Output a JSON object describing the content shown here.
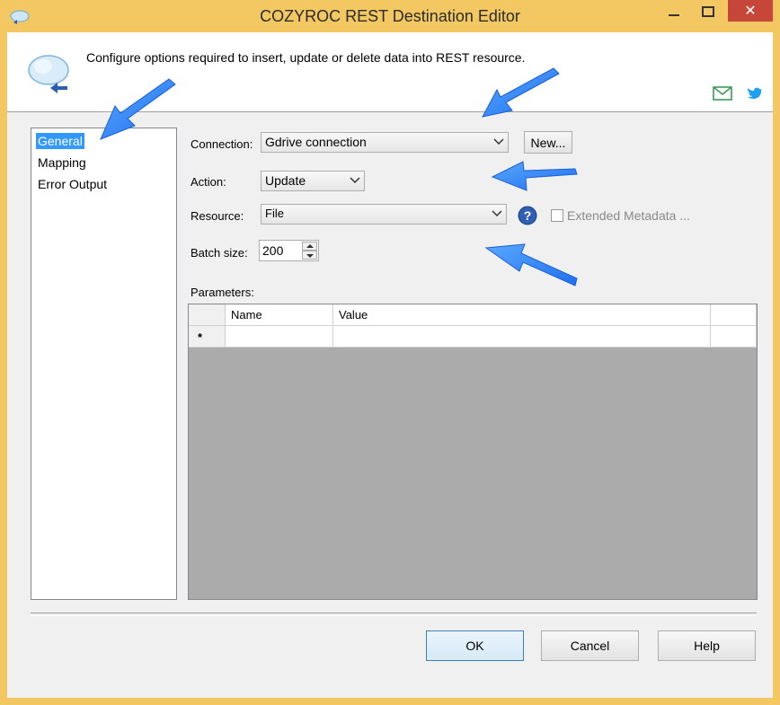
{
  "window": {
    "title": "COZYROC REST Destination Editor",
    "close_glyph": "✕"
  },
  "header": {
    "description": "Configure options required to insert, update or delete data into REST resource.",
    "icons": [
      "cloud-icon",
      "email-icon",
      "twitter-icon"
    ]
  },
  "nav": {
    "items": [
      {
        "label": "General",
        "selected": true
      },
      {
        "label": "Mapping",
        "selected": false
      },
      {
        "label": "Error Output",
        "selected": false
      }
    ]
  },
  "form": {
    "connection_label": "Connection:",
    "connection_value": "Gdrive connection",
    "new_button": "New...",
    "action_label": "Action:",
    "action_value": "Update",
    "resource_label": "Resource:",
    "resource_value": "File",
    "extended_metadata_label": "Extended Metadata ...",
    "batch_size_label": "Batch size:",
    "batch_size_value": "200",
    "parameters_label": "Parameters:"
  },
  "grid": {
    "columns": [
      "Name",
      "Value"
    ],
    "new_row_marker": "*"
  },
  "footer": {
    "ok": "OK",
    "cancel": "Cancel",
    "help": "Help"
  },
  "colors": {
    "titlebar": "#f3c862",
    "close": "#c7463a",
    "selection": "#3399ff",
    "annotation_arrow": "#1e7fff"
  }
}
